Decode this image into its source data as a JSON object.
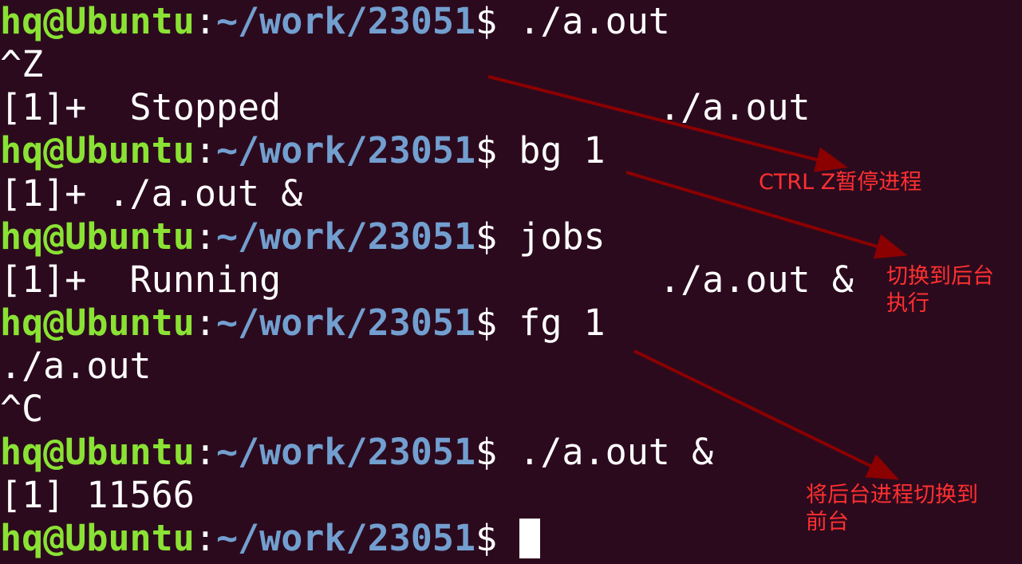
{
  "prompt": {
    "user_host": "hq@Ubuntu",
    "colon": ":",
    "path": "~/work/23051",
    "dollar": "$"
  },
  "lines": {
    "l1_cmd": " ./a.out",
    "l2_out": "^Z",
    "l3_out_a": "[1]+  Stopped",
    "l3_out_b": "./a.out",
    "l4_cmd": " bg 1",
    "l5_out": "[1]+ ./a.out &",
    "l6_cmd": " jobs",
    "l7_out_a": "[1]+  Running",
    "l7_out_b": "./a.out &",
    "l8_cmd": " fg 1",
    "l9_out": "./a.out",
    "l10_out": "^C",
    "l11_cmd": " ./a.out &",
    "l12_out": "[1] 11566",
    "l13_cmd": " "
  },
  "annotations": {
    "ctrl_z": "CTRL Z暂停进程",
    "to_background": "切换到后台\n执行",
    "to_foreground": "将后台进程切换到\n前台"
  },
  "colors": {
    "background": "#2c0a1e",
    "user_host": "#8ae234",
    "path": "#729fcf",
    "text": "#ffffff",
    "annotation": "#ff3030",
    "arrow": "#8b0000"
  }
}
